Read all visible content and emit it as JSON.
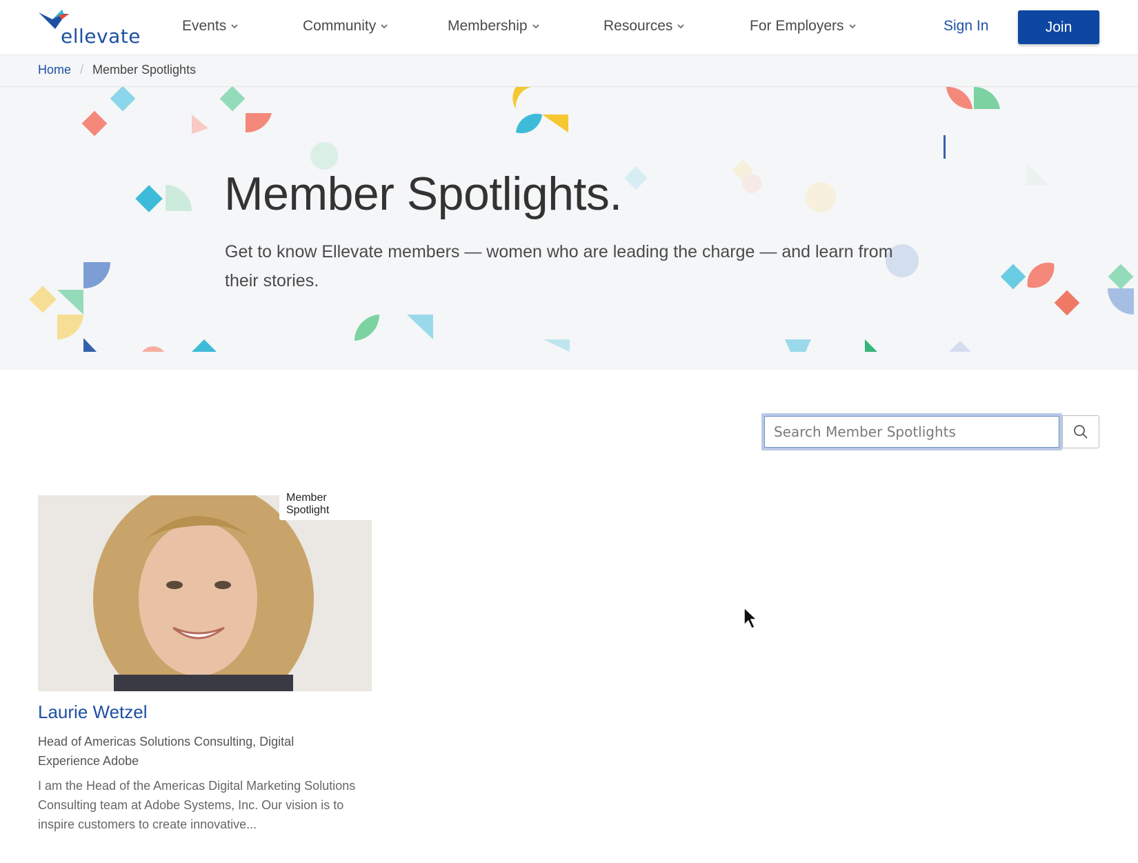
{
  "header": {
    "logo_text": "ellevate",
    "nav": [
      {
        "label": "Events"
      },
      {
        "label": "Community"
      },
      {
        "label": "Membership"
      },
      {
        "label": "Resources"
      },
      {
        "label": "For Employers"
      }
    ],
    "sign_in": "Sign In",
    "join": "Join"
  },
  "breadcrumb": {
    "home": "Home",
    "separator": "/",
    "current": "Member Spotlights"
  },
  "hero": {
    "title": "Member Spotlights.",
    "subtitle": "Get to know Ellevate members — women who are leading the charge — and learn from their stories."
  },
  "search": {
    "placeholder": "Search Member Spotlights"
  },
  "spotlights": [
    {
      "tag": "Member Spotlight",
      "name": "Laurie Wetzel",
      "role": "Head of Americas Solutions Consulting, Digital Experience Adobe",
      "description": "I am the Head of the Americas Digital Marketing Solutions Consulting team at Adobe Systems, Inc. Our vision is to inspire customers to create innovative..."
    }
  ],
  "icons": {
    "logo": "bird-logo-icon",
    "nav_chevron": "chevron-down-icon",
    "search": "search-icon",
    "cursor": "mouse-cursor-icon"
  },
  "colors": {
    "brand_blue": "#1d50a3",
    "join_button": "#0d47a1",
    "hero_background": "#f5f6f8"
  }
}
